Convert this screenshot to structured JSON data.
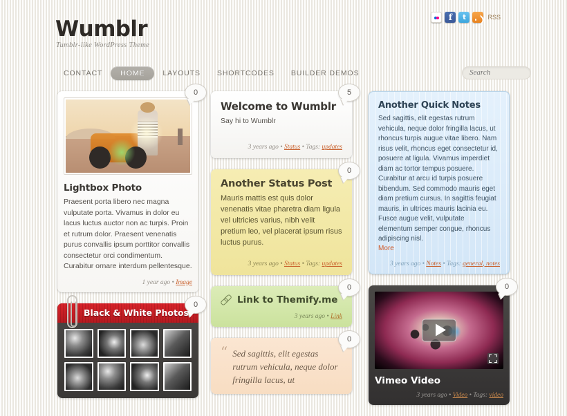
{
  "site": {
    "logo": "Wumblr",
    "tagline": "Tumblr-like WordPress Theme"
  },
  "social": {
    "rss_label": "RSS",
    "items": [
      "flickr-icon",
      "facebook-icon",
      "twitter-icon",
      "rss-icon"
    ]
  },
  "nav": {
    "items": [
      {
        "label": "CONTACT",
        "active": false
      },
      {
        "label": "HOME",
        "active": true
      },
      {
        "label": "LAYOUTS",
        "active": false
      },
      {
        "label": "SHORTCODES",
        "active": false
      },
      {
        "label": "BUILDER DEMOS",
        "active": false
      }
    ]
  },
  "search": {
    "placeholder": "Search",
    "value": ""
  },
  "posts": {
    "lightbox_photo": {
      "comments": "0",
      "title": "Lightbox Photo",
      "body": "Praesent porta libero nec magna vulputate porta. Vivamus in dolor eu lacus luctus auctor non ac turpis. Proin et rutrum dolor. Praesent venenatis purus convallis ipsum porttitor convallis consectetur orci condimentum. Curabitur ornare interdum pellentesque.",
      "meta_time": "1 year ago",
      "meta_sep": " • ",
      "meta_category": "Image"
    },
    "black_white": {
      "comments": "0",
      "title": "Black & White Photos",
      "thumbnails": 8
    },
    "welcome": {
      "comments": "5",
      "title": "Welcome to Wumblr",
      "body": "Say hi to Wumblr",
      "meta_time": "3 years ago",
      "meta_sep": " • ",
      "meta_category": "Status",
      "meta_tags_label": " • Tags: ",
      "meta_tags": "updates"
    },
    "another_status": {
      "comments": "0",
      "title": "Another Status Post",
      "body": "Mauris mattis est quis dolor venenatis vitae pharetra diam ligula vel ultricies varius, nibh velit pretium leo, vel placerat ipsum risus luctus purus.",
      "meta_time": "3 years ago",
      "meta_sep": " • ",
      "meta_category": "Status",
      "meta_tags_label": " • Tags: ",
      "meta_tags": "updates"
    },
    "link_post": {
      "comments": "0",
      "title": "Link to Themify.me",
      "meta_time": "3 years ago",
      "meta_sep": " • ",
      "meta_category": "Link"
    },
    "quote_post": {
      "comments": "0",
      "quote_mark": "“",
      "body": "Sed sagittis, elit egestas rutrum vehicula, neque dolor fringilla lacus, ut"
    },
    "quick_notes": {
      "comments": "",
      "title": "Another Quick Notes",
      "body": "Sed sagittis, elit egestas rutrum vehicula, neque dolor fringilla lacus, ut rhoncus turpis augue vitae libero. Nam risus velit, rhoncus eget consectetur id, posuere at ligula. Vivamus imperdiet diam ac tortor tempus posuere. Curabitur at arcu id turpis posuere bibendum. Sed commodo mauris eget diam pretium cursus. In sagittis feugiat mauris, in ultrices mauris lacinia eu. Fusce augue velit, vulputate elementum semper congue, rhoncus adipiscing nisl.",
      "more": "More",
      "meta_time": "3 years ago",
      "meta_sep": " • ",
      "meta_category": "Notes",
      "meta_tags_label": " • Tags: ",
      "meta_tags": "general, notes"
    },
    "vimeo_video": {
      "comments": "0",
      "title": "Vimeo Video",
      "meta_time": "3 years ago",
      "meta_sep": " • ",
      "meta_category": "Video",
      "meta_tags_label": " • Tags: ",
      "meta_tags": "video"
    }
  },
  "colors": {
    "page_bg": "#f2f0eb",
    "accent_link": "#c8602c",
    "nav_active_bg": "#a5a29b",
    "yellow_card": "#f2e8a8",
    "green_card": "#d3e6a9",
    "orange_card": "#f9e1c9",
    "blue_card": "#dbecf9",
    "red_band": "#c61f26",
    "dark_card": "#3a3836"
  }
}
